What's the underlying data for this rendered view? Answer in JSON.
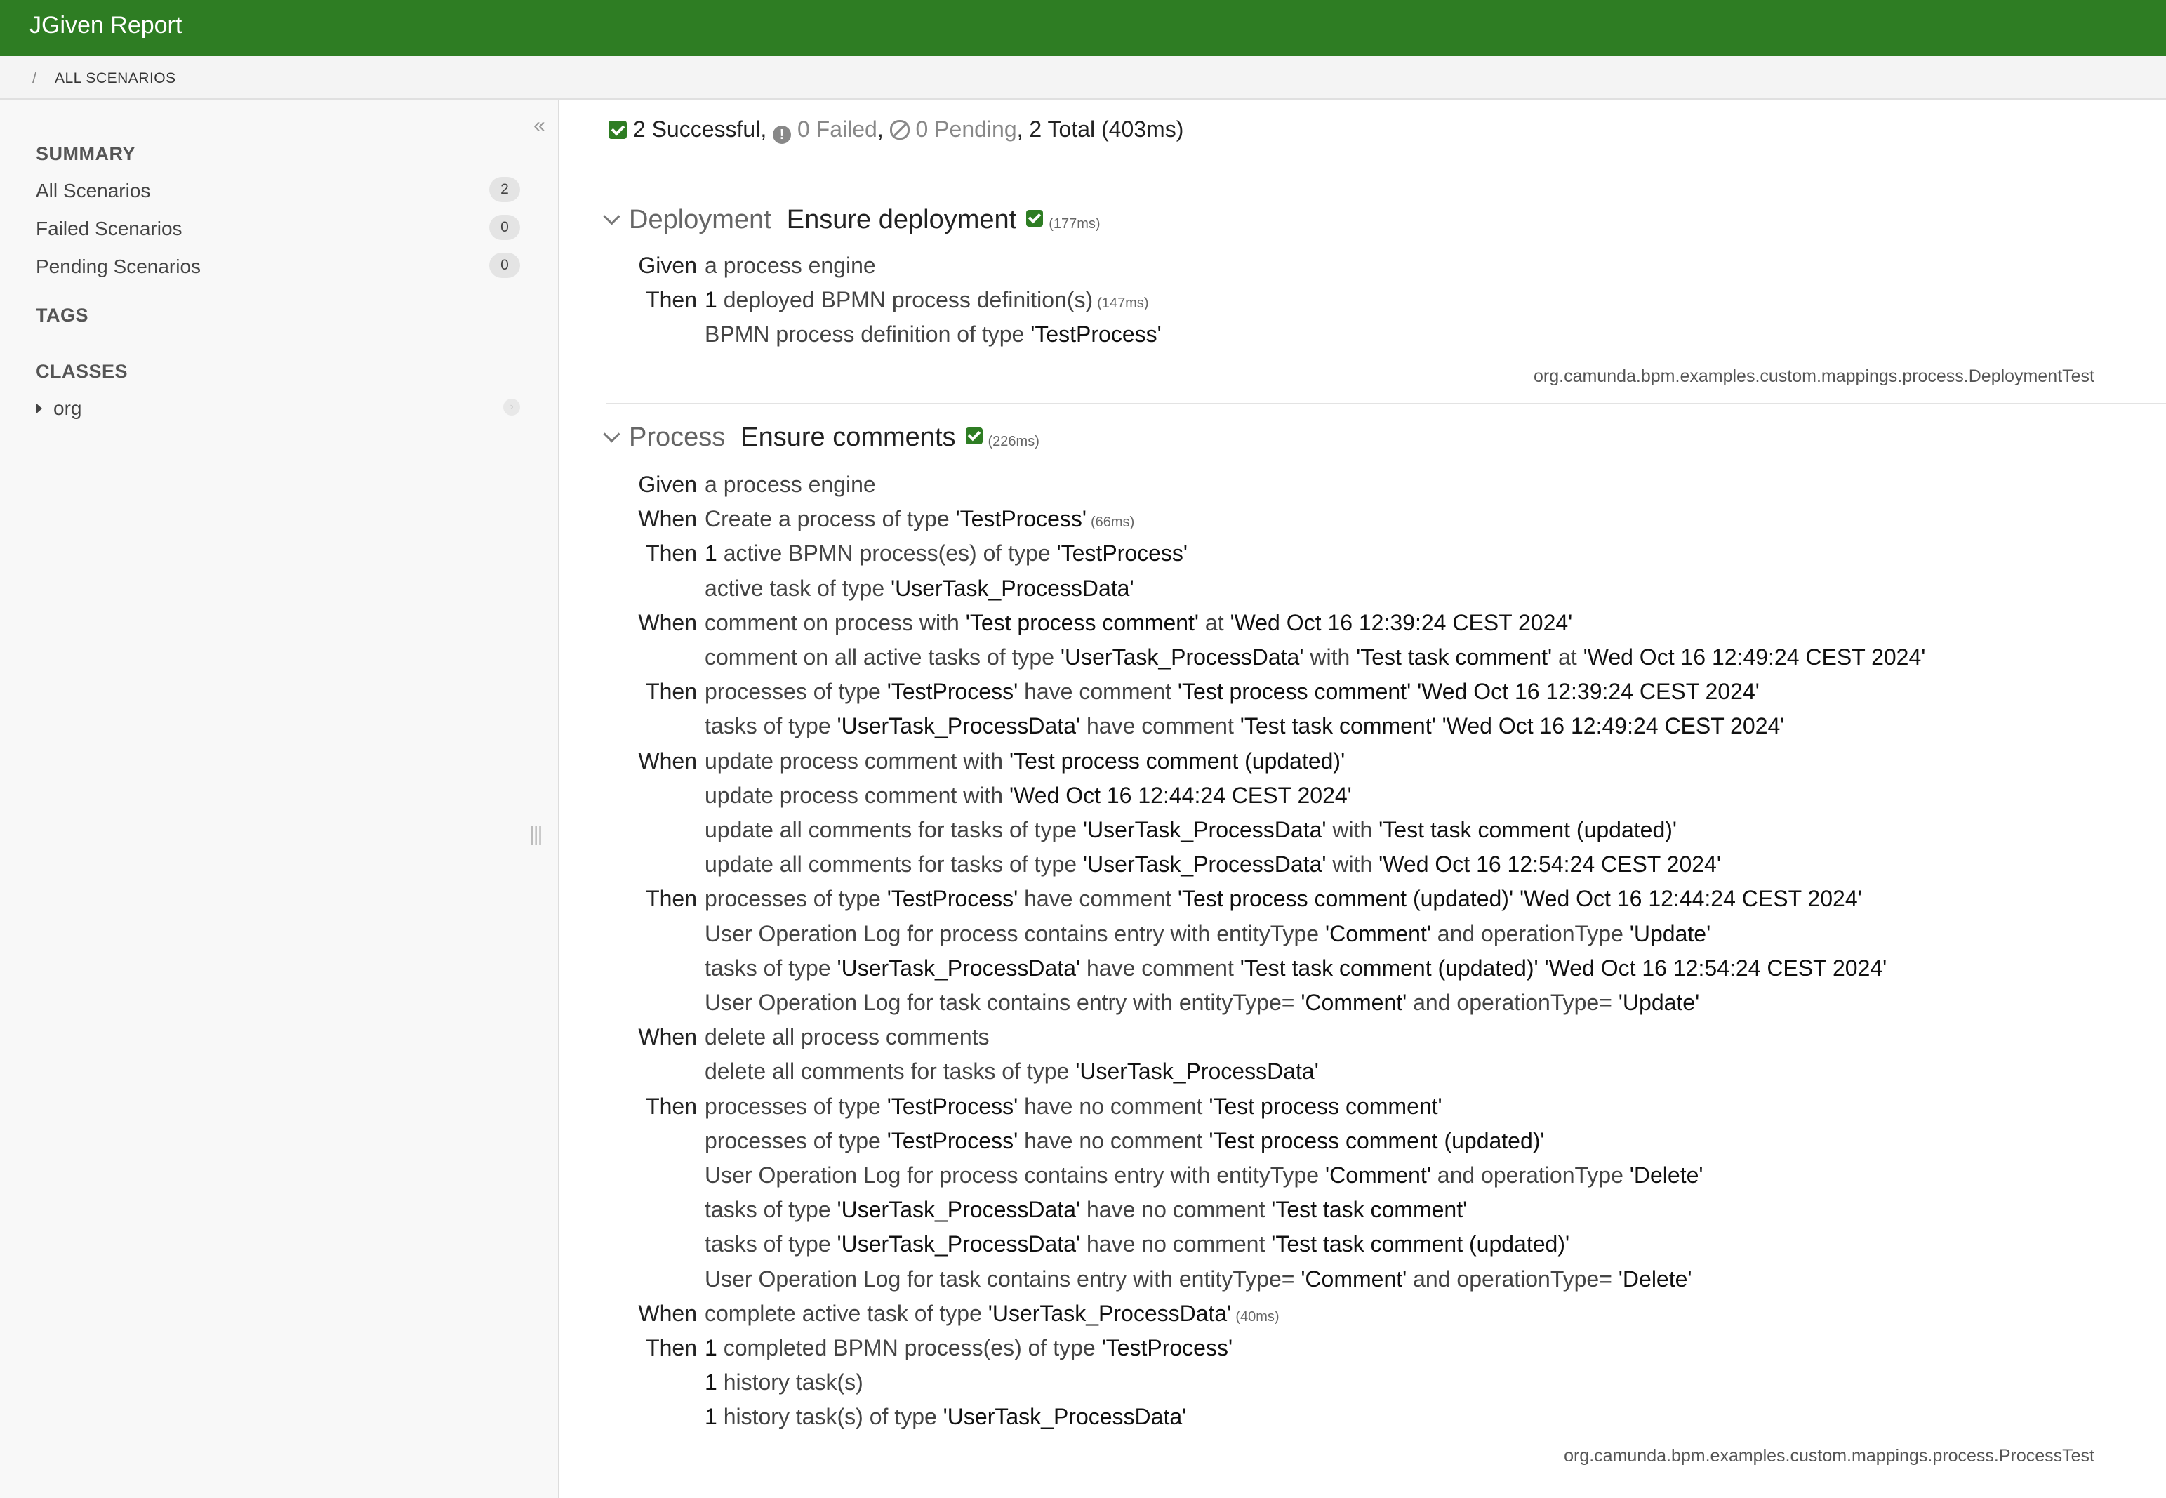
{
  "app": {
    "title": "JGiven Report"
  },
  "breadcrumb": {
    "separator": "/",
    "item": "ALL SCENARIOS"
  },
  "sidebar": {
    "summary_heading": "SUMMARY",
    "summary_items": [
      {
        "label": "All Scenarios",
        "count": "2"
      },
      {
        "label": "Failed Scenarios",
        "count": "0"
      },
      {
        "label": "Pending Scenarios",
        "count": "0"
      }
    ],
    "tags_heading": "TAGS",
    "classes_heading": "CLASSES",
    "class_tree": [
      {
        "label": "org"
      }
    ]
  },
  "stats": {
    "successful": "2 Successful",
    "failed": "0 Failed",
    "pending": "0 Pending",
    "total": "2 Total (403ms)"
  },
  "scenarios": [
    {
      "category": "Deployment",
      "title": "Ensure deployment",
      "duration": "(177ms)",
      "class_name": "org.camunda.bpm.examples.custom.mappings.process.DeploymentTest",
      "steps": [
        {
          "keyword": "Given",
          "parts": [
            [
              "a process engine",
              false
            ]
          ]
        },
        {
          "keyword": "Then",
          "parts": [
            [
              "1",
              true
            ],
            [
              " deployed BPMN process definition(s)",
              false
            ]
          ],
          "duration": "(147ms)"
        },
        {
          "keyword": "",
          "parts": [
            [
              "BPMN process definition of type ",
              false
            ],
            [
              "'TestProcess'",
              true
            ]
          ]
        }
      ]
    },
    {
      "category": "Process",
      "title": "Ensure comments",
      "duration": "(226ms)",
      "class_name": "org.camunda.bpm.examples.custom.mappings.process.ProcessTest",
      "steps": [
        {
          "keyword": "Given",
          "parts": [
            [
              "a process engine",
              false
            ]
          ]
        },
        {
          "keyword": "When",
          "parts": [
            [
              "Create a process of type ",
              false
            ],
            [
              "'TestProcess'",
              true
            ]
          ],
          "duration": "(66ms)"
        },
        {
          "keyword": "Then",
          "parts": [
            [
              "1",
              true
            ],
            [
              " active BPMN process(es) of type ",
              false
            ],
            [
              "'TestProcess'",
              true
            ]
          ]
        },
        {
          "keyword": "",
          "parts": [
            [
              "active task of type ",
              false
            ],
            [
              "'UserTask_ProcessData'",
              true
            ]
          ]
        },
        {
          "keyword": "When",
          "parts": [
            [
              "comment on process with ",
              false
            ],
            [
              "'Test process comment'",
              true
            ],
            [
              " at ",
              false
            ],
            [
              "'Wed Oct 16 12:39:24 CEST 2024'",
              true
            ]
          ]
        },
        {
          "keyword": "",
          "parts": [
            [
              "comment on all active tasks of type ",
              false
            ],
            [
              "'UserTask_ProcessData'",
              true
            ],
            [
              " with ",
              false
            ],
            [
              "'Test task comment'",
              true
            ],
            [
              " at ",
              false
            ],
            [
              "'Wed Oct 16 12:49:24 CEST 2024'",
              true
            ]
          ]
        },
        {
          "keyword": "Then",
          "parts": [
            [
              "processes of type ",
              false
            ],
            [
              "'TestProcess'",
              true
            ],
            [
              " have comment ",
              false
            ],
            [
              "'Test process comment'",
              true
            ],
            [
              " ",
              false
            ],
            [
              "'Wed Oct 16 12:39:24 CEST 2024'",
              true
            ]
          ]
        },
        {
          "keyword": "",
          "parts": [
            [
              "tasks of type ",
              false
            ],
            [
              "'UserTask_ProcessData'",
              true
            ],
            [
              " have comment ",
              false
            ],
            [
              "'Test task comment'",
              true
            ],
            [
              " ",
              false
            ],
            [
              "'Wed Oct 16 12:49:24 CEST 2024'",
              true
            ]
          ]
        },
        {
          "keyword": "When",
          "parts": [
            [
              "update process comment with ",
              false
            ],
            [
              "'Test process comment (updated)'",
              true
            ]
          ]
        },
        {
          "keyword": "",
          "parts": [
            [
              "update process comment with ",
              false
            ],
            [
              "'Wed Oct 16 12:44:24 CEST 2024'",
              true
            ]
          ]
        },
        {
          "keyword": "",
          "parts": [
            [
              "update all comments for tasks of type ",
              false
            ],
            [
              "'UserTask_ProcessData'",
              true
            ],
            [
              " with ",
              false
            ],
            [
              "'Test task comment (updated)'",
              true
            ]
          ]
        },
        {
          "keyword": "",
          "parts": [
            [
              "update all comments for tasks of type ",
              false
            ],
            [
              "'UserTask_ProcessData'",
              true
            ],
            [
              " with ",
              false
            ],
            [
              "'Wed Oct 16 12:54:24 CEST 2024'",
              true
            ]
          ]
        },
        {
          "keyword": "Then",
          "parts": [
            [
              "processes of type ",
              false
            ],
            [
              "'TestProcess'",
              true
            ],
            [
              " have comment ",
              false
            ],
            [
              "'Test process comment (updated)'",
              true
            ],
            [
              " ",
              false
            ],
            [
              "'Wed Oct 16 12:44:24 CEST 2024'",
              true
            ]
          ]
        },
        {
          "keyword": "",
          "parts": [
            [
              "User Operation Log for process contains entry with entityType ",
              false
            ],
            [
              "'Comment'",
              true
            ],
            [
              " and operationType ",
              false
            ],
            [
              "'Update'",
              true
            ]
          ]
        },
        {
          "keyword": "",
          "parts": [
            [
              "tasks of type ",
              false
            ],
            [
              "'UserTask_ProcessData'",
              true
            ],
            [
              " have comment ",
              false
            ],
            [
              "'Test task comment (updated)'",
              true
            ],
            [
              " ",
              false
            ],
            [
              "'Wed Oct 16 12:54:24 CEST 2024'",
              true
            ]
          ]
        },
        {
          "keyword": "",
          "parts": [
            [
              "User Operation Log for task contains entry with entityType= ",
              false
            ],
            [
              "'Comment'",
              true
            ],
            [
              " and operationType= ",
              false
            ],
            [
              "'Update'",
              true
            ]
          ]
        },
        {
          "keyword": "When",
          "parts": [
            [
              "delete all process comments",
              false
            ]
          ]
        },
        {
          "keyword": "",
          "parts": [
            [
              "delete all comments for tasks of type ",
              false
            ],
            [
              "'UserTask_ProcessData'",
              true
            ]
          ]
        },
        {
          "keyword": "Then",
          "parts": [
            [
              "processes of type ",
              false
            ],
            [
              "'TestProcess'",
              true
            ],
            [
              " have no comment ",
              false
            ],
            [
              "'Test process comment'",
              true
            ]
          ]
        },
        {
          "keyword": "",
          "parts": [
            [
              "processes of type ",
              false
            ],
            [
              "'TestProcess'",
              true
            ],
            [
              " have no comment ",
              false
            ],
            [
              "'Test process comment (updated)'",
              true
            ]
          ]
        },
        {
          "keyword": "",
          "parts": [
            [
              "User Operation Log for process contains entry with entityType ",
              false
            ],
            [
              "'Comment'",
              true
            ],
            [
              " and operationType ",
              false
            ],
            [
              "'Delete'",
              true
            ]
          ]
        },
        {
          "keyword": "",
          "parts": [
            [
              "tasks of type ",
              false
            ],
            [
              "'UserTask_ProcessData'",
              true
            ],
            [
              " have no comment ",
              false
            ],
            [
              "'Test task comment'",
              true
            ]
          ]
        },
        {
          "keyword": "",
          "parts": [
            [
              "tasks of type ",
              false
            ],
            [
              "'UserTask_ProcessData'",
              true
            ],
            [
              " have no comment ",
              false
            ],
            [
              "'Test task comment (updated)'",
              true
            ]
          ]
        },
        {
          "keyword": "",
          "parts": [
            [
              "User Operation Log for task contains entry with entityType= ",
              false
            ],
            [
              "'Comment'",
              true
            ],
            [
              " and operationType= ",
              false
            ],
            [
              "'Delete'",
              true
            ]
          ]
        },
        {
          "keyword": "When",
          "parts": [
            [
              "complete active task of type ",
              false
            ],
            [
              "'UserTask_ProcessData'",
              true
            ]
          ],
          "duration": "(40ms)"
        },
        {
          "keyword": "Then",
          "parts": [
            [
              "1",
              true
            ],
            [
              " completed BPMN process(es) of type ",
              false
            ],
            [
              "'TestProcess'",
              true
            ]
          ]
        },
        {
          "keyword": "",
          "parts": [
            [
              "1",
              true
            ],
            [
              " history task(s)",
              false
            ]
          ]
        },
        {
          "keyword": "",
          "parts": [
            [
              "1",
              true
            ],
            [
              " history task(s) of type ",
              false
            ],
            [
              "'UserTask_ProcessData'",
              true
            ]
          ]
        }
      ]
    }
  ],
  "colors": {
    "brand": "#2e7d23",
    "success": "#2e7d23",
    "muted": "#888888"
  },
  "icons": {
    "collapse": "double-chevron-left-icon",
    "successful": "check-square-icon",
    "failed": "exclamation-circle-icon",
    "pending": "ban-icon",
    "expand": "chevron-down-icon"
  }
}
